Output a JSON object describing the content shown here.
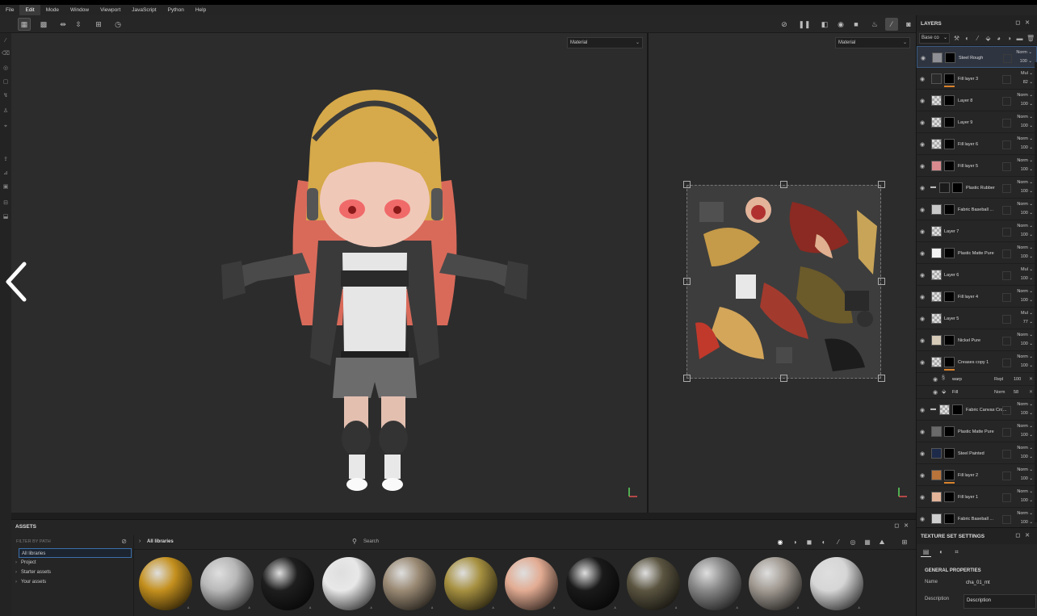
{
  "menu": [
    "File",
    "Edit",
    "Mode",
    "Window",
    "Viewport",
    "JavaScript",
    "Python",
    "Help"
  ],
  "menu_active": "Edit",
  "viewport3d": {
    "material_label": "Material"
  },
  "viewport2d": {
    "material_label": "Material"
  },
  "layers_panel": {
    "title": "LAYERS",
    "channel": "Base co",
    "layers": [
      {
        "name": "Steel Rough",
        "blend": "Norm",
        "opacity": "100",
        "thumb": "#8e9096",
        "selected": true
      },
      {
        "name": "Fill layer 3",
        "blend": "Mul",
        "opacity": "82",
        "thumb": "dark",
        "bar": true
      },
      {
        "name": "Layer 8",
        "blend": "Norm",
        "opacity": "100",
        "thumb": "checker"
      },
      {
        "name": "Layer 9",
        "blend": "Norm",
        "opacity": "100",
        "thumb": "checker"
      },
      {
        "name": "Fill layer 6",
        "blend": "Norm",
        "opacity": "100",
        "thumb": "checker"
      },
      {
        "name": "Fill layer 5",
        "blend": "Norm",
        "opacity": "100",
        "thumb": "#d88a8e"
      },
      {
        "name": "Plastic Rubber",
        "blend": "Norm",
        "opacity": "100",
        "thumb": "#1a1a1a",
        "folder": true
      },
      {
        "name": "Fabric Baseball ...",
        "blend": "Norm",
        "opacity": "100",
        "thumb": "#c8c8c8"
      },
      {
        "name": "Layer 7",
        "blend": "Norm",
        "opacity": "100",
        "thumb": "checker",
        "nomask": true
      },
      {
        "name": "Plastic Matte Pure",
        "blend": "Norm",
        "opacity": "100",
        "thumb": "#f2f2f2"
      },
      {
        "name": "Layer 6",
        "blend": "Mul",
        "opacity": "100",
        "thumb": "checker",
        "nomask": true
      },
      {
        "name": "Fill layer 4",
        "blend": "Norm",
        "opacity": "100",
        "thumb": "checker"
      },
      {
        "name": "Layer 5",
        "blend": "Mul",
        "opacity": "77",
        "thumb": "checker",
        "nomask": true
      },
      {
        "name": "Nickel Pure",
        "blend": "Norm",
        "opacity": "100",
        "thumb": "#d6cbb8"
      },
      {
        "name": "Creases copy 1",
        "blend": "Norm",
        "opacity": "100",
        "thumb": "checker",
        "bar": true
      }
    ],
    "sub_rows": [
      {
        "name": "warp",
        "blend": "Repl",
        "opacity": "100"
      },
      {
        "name": "Fill",
        "blend": "Norm",
        "opacity": "58"
      }
    ],
    "layers_after": [
      {
        "name": "Fabric Canvas Cro...",
        "blend": "Norm",
        "opacity": "100",
        "thumb": "checker",
        "folder": true
      },
      {
        "name": "Plastic Matte Pure",
        "blend": "Norm",
        "opacity": "100",
        "thumb": "#6a6a6a"
      },
      {
        "name": "Steel Painted",
        "blend": "Norm",
        "opacity": "100",
        "thumb": "#1d2a4a"
      },
      {
        "name": "Fill layer 2",
        "blend": "Norm",
        "opacity": "100",
        "thumb": "#b8743a",
        "bar": true
      },
      {
        "name": "Fill layer 1",
        "blend": "Norm",
        "opacity": "100",
        "thumb": "#e3b49a"
      },
      {
        "name": "Fabric Baseball ...",
        "blend": "Norm",
        "opacity": "100",
        "thumb": "#cfcfcf"
      }
    ]
  },
  "texture_set_settings": {
    "title": "TEXTURE SET SETTINGS",
    "section": "GENERAL PROPERTIES",
    "name_label": "Name",
    "name_value": "cha_01_mt",
    "description_label": "Description",
    "description_value": "Description"
  },
  "assets": {
    "title": "ASSETS",
    "filter_placeholder": "FILTER BY PATH",
    "tree": [
      "All libraries",
      "Project",
      "Starter assets",
      "Your assets"
    ],
    "library_title": "All libraries",
    "search_placeholder": "Search",
    "materials": [
      {
        "icon": "gold-hex-material",
        "color": "#c4901e"
      },
      {
        "icon": "chrome-material",
        "color": "#b8b8b8"
      },
      {
        "icon": "black-plastic-material",
        "color": "#1e1e1e"
      },
      {
        "icon": "leaf-decal-material",
        "color": "#e8e8e8"
      },
      {
        "icon": "beige-material",
        "color": "#9a8a74"
      },
      {
        "icon": "brass-material",
        "color": "#a69040"
      },
      {
        "icon": "skin-material",
        "color": "#e2ab92"
      },
      {
        "icon": "carbon-fiber-material",
        "color": "#1a1a1a"
      },
      {
        "icon": "olive-metal-material",
        "color": "#5a5440"
      },
      {
        "icon": "silver-material",
        "color": "#888"
      },
      {
        "icon": "concrete-material",
        "color": "#a19a92"
      },
      {
        "icon": "white-plaster-material",
        "color": "#d6d6d6"
      }
    ]
  },
  "colors": {
    "accent": "#3b6fa8",
    "layer_bar": "#d9822b",
    "panel_bg": "#262626",
    "viewport_bg": "#2c2c2c"
  }
}
